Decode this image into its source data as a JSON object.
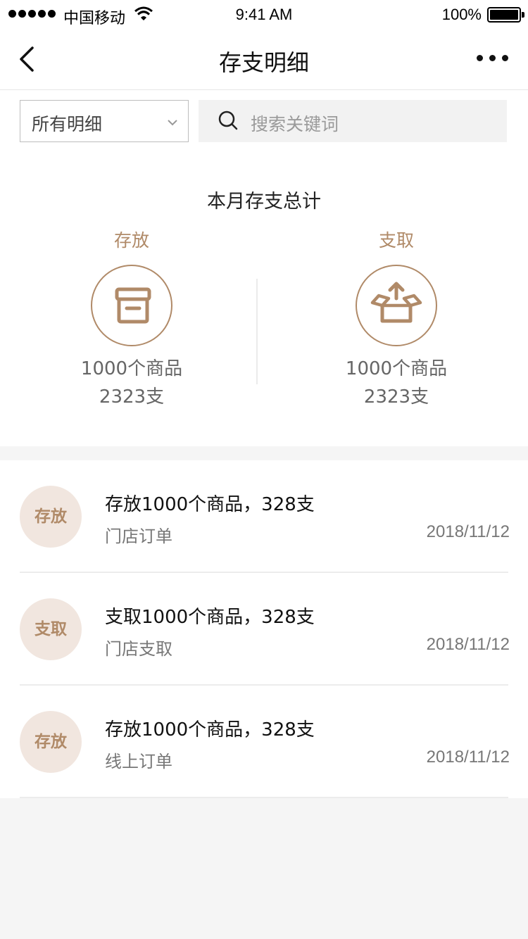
{
  "status_bar": {
    "carrier": "中国移动",
    "time": "9:41 AM",
    "battery": "100%",
    "signal_icon": "signal-dots-icon",
    "wifi_icon": "wifi-icon",
    "battery_icon": "battery-icon"
  },
  "nav": {
    "title": "存支明细",
    "back_icon": "chevron-left-icon",
    "more_icon": "more-dots-icon"
  },
  "filter": {
    "dropdown_value": "所有明细",
    "search_placeholder": "搜索关键词"
  },
  "summary": {
    "title": "本月存支总计",
    "deposit": {
      "label": "存放",
      "items": "1000个商品",
      "count": "2323支",
      "icon": "archive-box-icon"
    },
    "withdraw": {
      "label": "支取",
      "items": "1000个商品",
      "count": "2323支",
      "icon": "open-box-upload-icon"
    }
  },
  "records": [
    {
      "badge": "存放",
      "title": "存放1000个商品，328支",
      "source": "门店订单",
      "date": "2018/11/12"
    },
    {
      "badge": "支取",
      "title": "支取1000个商品，328支",
      "source": "门店支取",
      "date": "2018/11/12"
    },
    {
      "badge": "存放",
      "title": "存放1000个商品，328支",
      "source": "线上订单",
      "date": "2018/11/12"
    }
  ],
  "colors": {
    "accent": "#b08a68",
    "badge_bg": "#f1e6df",
    "page_bg": "#f5f5f5"
  }
}
